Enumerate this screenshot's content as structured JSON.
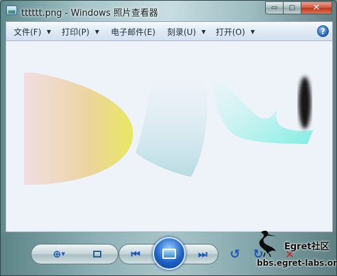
{
  "window": {
    "title": "tttttt.png - Windows 照片查看器",
    "minimize_glyph": "▭",
    "maximize_glyph": "▢",
    "close_glyph": "✕"
  },
  "menu": {
    "items": [
      {
        "label": "文件(F)",
        "has_dropdown": true
      },
      {
        "label": "打印(P)",
        "has_dropdown": true
      },
      {
        "label": "电子邮件(E)",
        "has_dropdown": false
      },
      {
        "label": "刻录(U)",
        "has_dropdown": true
      },
      {
        "label": "打开(O)",
        "has_dropdown": true
      }
    ],
    "help_glyph": "?"
  },
  "toolbar": {
    "zoom_icon": "magnifier-plus-icon",
    "fit_icon": "actual-size-icon",
    "prev_icon": "previous-icon",
    "slideshow_icon": "slideshow-icon",
    "next_icon": "next-icon",
    "rotate_ccw_icon": "rotate-counterclockwise-icon",
    "rotate_cw_icon": "rotate-clockwise-icon",
    "delete_icon": "delete-icon"
  },
  "watermark": {
    "title": "Egret社区",
    "url": "bbs.egret-labs.org"
  },
  "colors": {
    "canvas_bg": "#eef2f9",
    "shape1_start": "#f2d5d6",
    "shape1_end": "#e8e860",
    "shape2": "#bfe0e6",
    "shape3": "#7feee3",
    "shape4": "#141414"
  }
}
